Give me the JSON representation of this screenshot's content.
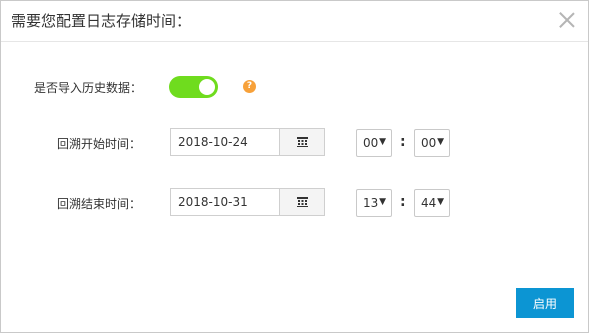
{
  "dialog": {
    "title": "需要您配置日志存储时间："
  },
  "import_history": {
    "label": "是否导入历史数据：",
    "enabled": true,
    "help_icon": "?"
  },
  "backtrack_start": {
    "label": "回溯开始时间：",
    "date": "2018-10-24",
    "hour": "00",
    "minute": "00"
  },
  "backtrack_end": {
    "label": "回溯结束时间：",
    "date": "2018-10-31",
    "hour": "13",
    "minute": "44"
  },
  "separator": ":",
  "dropdown_arrow": "▼",
  "footer": {
    "submit_label": "启用"
  },
  "colors": {
    "accent": "#0c95d3",
    "toggle_on": "#6fdc1e",
    "help": "#f7a13a"
  }
}
